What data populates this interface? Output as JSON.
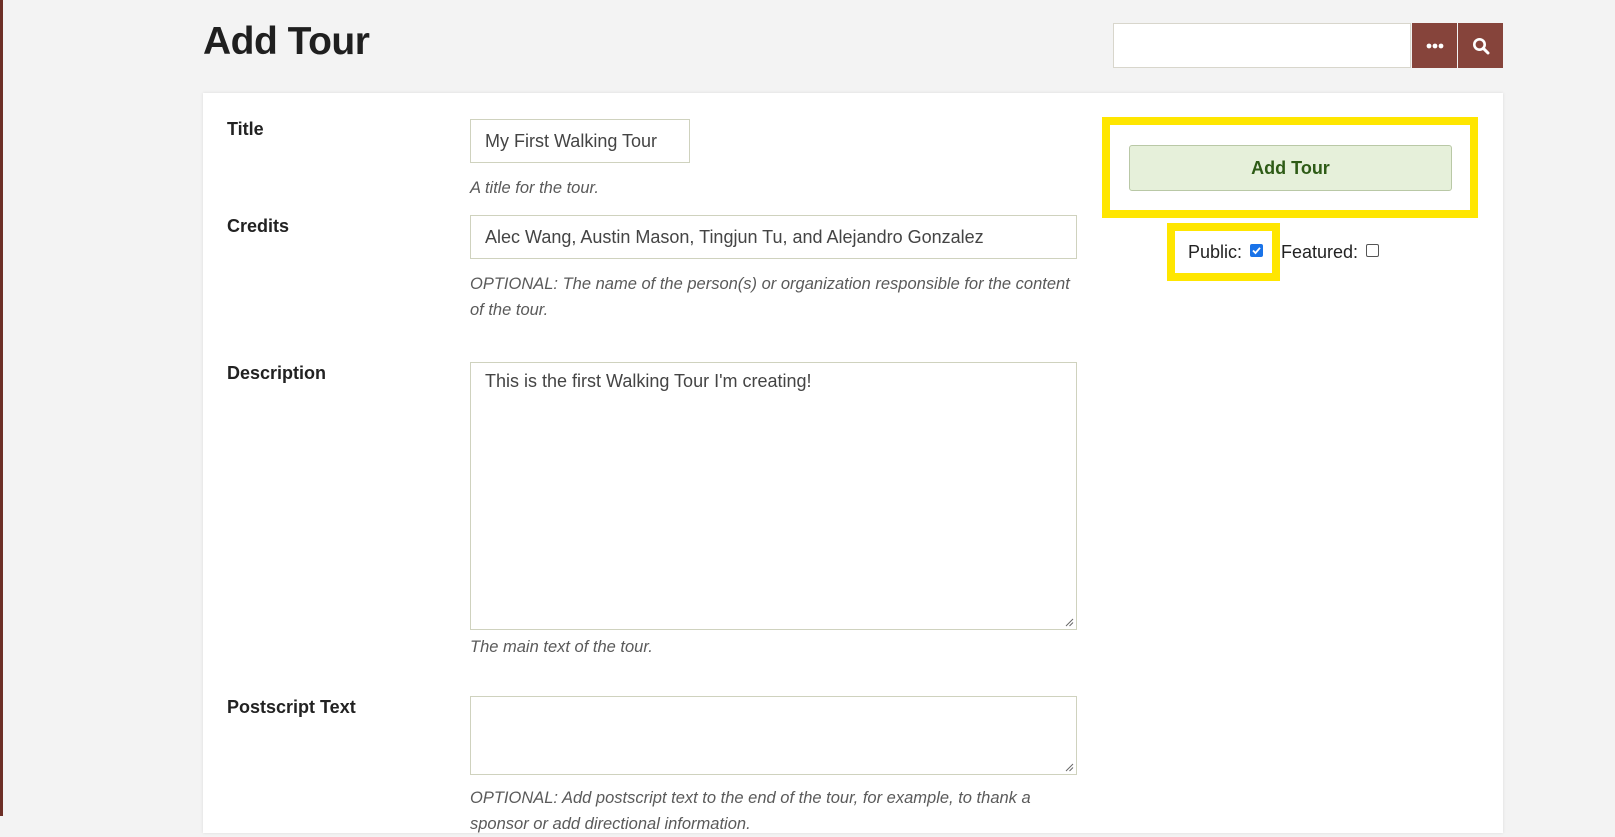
{
  "page": {
    "title": "Add Tour"
  },
  "search": {
    "value": "",
    "options_icon": "ellipsis-icon",
    "submit_icon": "search-icon"
  },
  "form": {
    "title": {
      "label": "Title",
      "value": "My First Walking Tour",
      "help": "A title for the tour."
    },
    "credits": {
      "label": "Credits",
      "value": "Alec Wang, Austin Mason, Tingjun Tu, and Alejandro Gonzalez",
      "help": "OPTIONAL: The name of the person(s) or organization responsible for the content of the tour."
    },
    "description": {
      "label": "Description",
      "value": "This is the first Walking Tour I'm creating!",
      "help": "The main text of the tour."
    },
    "postscript": {
      "label": "Postscript Text",
      "value": "",
      "help": "OPTIONAL: Add postscript text to the end of the tour, for example, to thank a sponsor or add directional information."
    }
  },
  "sidebar": {
    "submit_label": "Add Tour",
    "public_label": "Public:",
    "public_checked": true,
    "featured_label": "Featured:",
    "featured_checked": false
  },
  "colors": {
    "accent": "#86443b",
    "highlight": "#ffe600",
    "submit_bg": "#e6f0da",
    "submit_text": "#2e5b16",
    "checkbox_checked": "#1a73e8"
  }
}
